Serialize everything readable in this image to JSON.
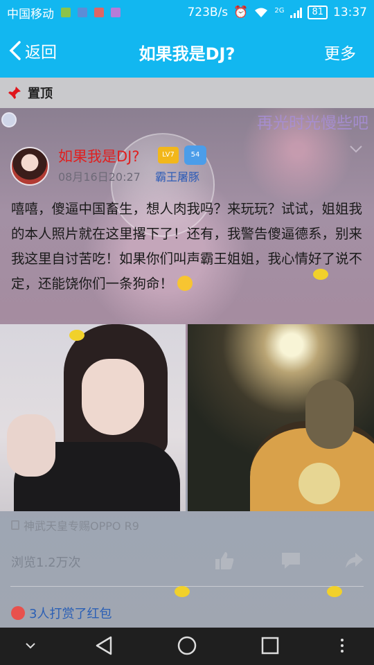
{
  "status_bar": {
    "carrier": "中国移动",
    "speed": "723B/s",
    "network": "2G",
    "battery": "81",
    "time": "13:37"
  },
  "header": {
    "back_label": "返回",
    "title": "如果我是DJ?",
    "more_label": "更多"
  },
  "pinned": {
    "label": "置顶"
  },
  "post": {
    "watermark": "再光时光慢些吧",
    "author": "如果我是DJ?",
    "badge_level": "LV7",
    "badge_rank": "54",
    "date": "08月16日20:27",
    "group": "霸王屠豚",
    "text": "嘻嘻，傻逼中国畜生，想人肉我吗？来玩玩？试试，姐姐我的本人照片就在这里撂下了！还有，我警告傻逼德系，别来我这里自讨苦吃！如果你们叫声霸王姐姐，我心情好了说不定，还能饶你们一条狗命！",
    "device": "神武天皇专赐OPPO R9",
    "views": "浏览1.2万次",
    "reward_text": "3人打赏了红包"
  },
  "colors": {
    "accent": "#12b7f0",
    "author_red": "#e02020",
    "link_blue": "#2a5fb5"
  },
  "icons": [
    "back-chevron-icon",
    "pin-icon",
    "clock-icon",
    "chevron-down-icon",
    "like-icon",
    "comment-icon",
    "share-icon",
    "red-packet-icon",
    "nav-back-icon",
    "nav-home-icon",
    "nav-recent-icon",
    "nav-menu-icon"
  ]
}
